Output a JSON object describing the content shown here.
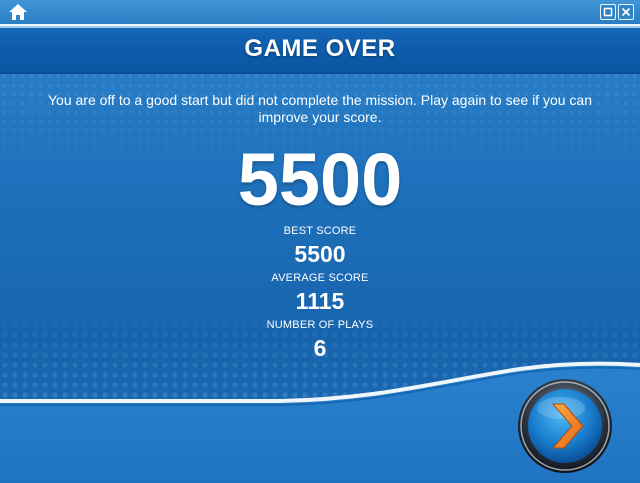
{
  "window": {
    "home_icon": "home-icon",
    "restore_icon": "restore-window-icon",
    "close_icon": "close-icon"
  },
  "header": {
    "title": "GAME OVER"
  },
  "main": {
    "message": "You are off to a good start but did not complete the mission. Play again to see if you can improve your score.",
    "score": "5500",
    "stats": [
      {
        "label": "BEST SCORE",
        "value": "5500"
      },
      {
        "label": "AVERAGE SCORE",
        "value": "1115"
      },
      {
        "label": "NUMBER OF PLAYS",
        "value": "6"
      }
    ]
  },
  "next_button": {
    "icon": "chevron-right-icon"
  },
  "colors": {
    "background": "#1a66b0",
    "header": "#0d5aa8",
    "accent_orange": "#f07a1a",
    "text": "#ffffff"
  }
}
